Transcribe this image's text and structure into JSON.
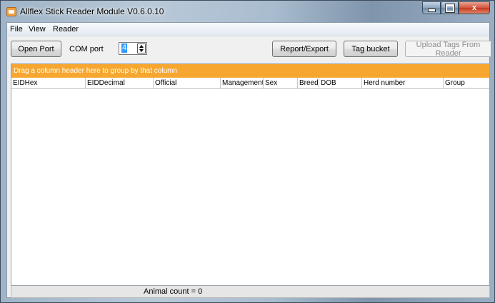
{
  "window": {
    "title": "Allflex Stick Reader Module V0.6.0.10",
    "controls": {
      "minimize": "–",
      "maximize": "□",
      "close": "x"
    }
  },
  "menu": {
    "items": [
      "File",
      "View",
      "Reader"
    ]
  },
  "toolbar": {
    "open_port_label": "Open Port",
    "com_port_label": "COM port",
    "com_port_value": "4",
    "report_export_label": "Report/Export",
    "tag_bucket_label": "Tag bucket",
    "upload_tags_label": "Upload Tags From Reader"
  },
  "grid": {
    "group_panel_text": "Drag a column header here to group by that column",
    "columns": [
      "EIDHex",
      "EIDDecimal",
      "Official",
      "Management",
      "Sex",
      "Breed",
      "DOB",
      "Herd number",
      "Group"
    ],
    "rows": []
  },
  "status": {
    "animal_count": "Animal count = 0"
  },
  "colors": {
    "group_panel": "#f7a72f",
    "selection": "#3399ff",
    "close_button": "#c23a1c"
  }
}
